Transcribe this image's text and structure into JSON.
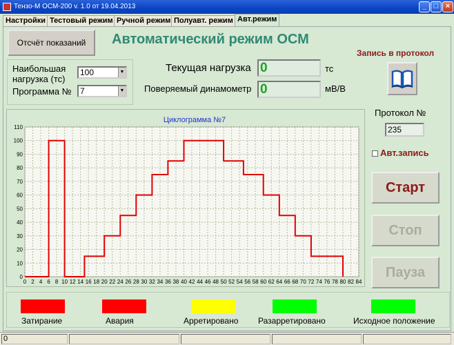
{
  "window": {
    "title": "Тензо-М   ОСМ-200   v. 1.0  от 19.04.2013"
  },
  "tabs": [
    {
      "label": "Настройки"
    },
    {
      "label": "Тестовый режим"
    },
    {
      "label": "Ручной режим"
    },
    {
      "label": "Полуавт. режим"
    },
    {
      "label": "Авт.режим"
    }
  ],
  "report_button": "Отсчёт показаний",
  "heading": "Автоматический режим ОСМ",
  "params": {
    "max_load_label_1": "Наибольшая",
    "max_load_label_2": "нагрузка (тс)",
    "max_load_value": "100",
    "program_label": "Программа №",
    "program_value": "7"
  },
  "readouts": {
    "load_label": "Текущая нагрузка",
    "load_value": "0",
    "load_unit": "тс",
    "dyn_label": "Поверяемый динамометр",
    "dyn_value": "0",
    "dyn_unit": "мВ/В"
  },
  "record": {
    "title": "Запись в протокол",
    "icon": "book-icon"
  },
  "protocol": {
    "label": "Протокол №",
    "value": "235"
  },
  "auto_record": {
    "label": "Авт.запись",
    "checked": false
  },
  "buttons": {
    "start": "Старт",
    "stop": "Стоп",
    "pause": "Пауза"
  },
  "indicators": [
    {
      "label": "Затирание",
      "color": "#ff0000"
    },
    {
      "label": "Авария",
      "color": "#ff0000"
    },
    {
      "label": "Арретировано",
      "color": "#ffff00"
    },
    {
      "label": "Разарретировано",
      "color": "#00ff00"
    },
    {
      "label": "Исходное положение",
      "color": "#00ff00"
    }
  ],
  "status": {
    "field1": "0"
  },
  "chart_data": {
    "type": "line",
    "title": "Циклограмма №7",
    "xlim": [
      0,
      84
    ],
    "ylim": [
      0,
      110
    ],
    "x_ticks": [
      0,
      2,
      4,
      6,
      8,
      10,
      12,
      14,
      16,
      18,
      20,
      22,
      24,
      26,
      28,
      30,
      32,
      34,
      36,
      38,
      40,
      42,
      44,
      46,
      48,
      50,
      52,
      54,
      56,
      58,
      60,
      62,
      64,
      66,
      68,
      70,
      72,
      74,
      76,
      78,
      80,
      82,
      84
    ],
    "y_ticks": [
      0,
      10,
      20,
      30,
      40,
      50,
      60,
      70,
      80,
      90,
      100,
      110
    ],
    "grid": true,
    "line_color": "#e00000",
    "series": [
      {
        "x": [
          0,
          6,
          6,
          10,
          10,
          15,
          15,
          20,
          20,
          24,
          24,
          28,
          28,
          32,
          32,
          36,
          36,
          40,
          40,
          45,
          45,
          50,
          50,
          55,
          55,
          60,
          60,
          64,
          64,
          68,
          68,
          72,
          72,
          76,
          76,
          80,
          80
        ],
        "y": [
          0,
          0,
          100,
          100,
          0,
          0,
          15,
          15,
          30,
          30,
          45,
          45,
          60,
          60,
          75,
          75,
          85,
          85,
          100,
          100,
          100,
          100,
          85,
          85,
          75,
          75,
          60,
          60,
          45,
          45,
          30,
          30,
          15,
          15,
          15,
          15,
          0
        ]
      }
    ]
  }
}
